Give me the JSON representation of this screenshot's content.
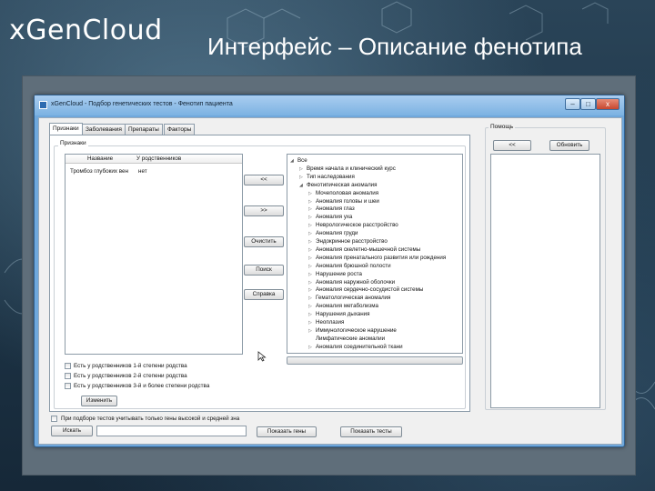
{
  "slide": {
    "logo": {
      "x": "x",
      "gen": "Gen",
      "cloud": "Cloud"
    },
    "title": "Интерфейс – Описание фенотипа"
  },
  "window": {
    "title": "xGenCloud - Подбор генетических тестов - Фенотип пациента",
    "controls": {
      "minimize": "–",
      "maximize": "□",
      "close": "x"
    }
  },
  "tabs": [
    "Признаки",
    "Заболевания",
    "Препараты",
    "Факторы"
  ],
  "features": {
    "group_label": "Признаки",
    "columns": [
      "Название",
      "У родственников"
    ],
    "rows": [
      {
        "name": "Тромбоз глубоких вен",
        "relatives": "нет"
      }
    ]
  },
  "buttons": {
    "move_left": "<<",
    "move_right": ">>",
    "clear": "Очистить",
    "search": "Поиск",
    "help": "Справка",
    "change": "Изменить",
    "find": "Искать",
    "show_genes": "Показать гены",
    "show_tests": "Показать тесты"
  },
  "tree": [
    {
      "label": "Все",
      "level": 0,
      "expanded": true
    },
    {
      "label": "Время начала и клинический курс",
      "level": 1,
      "expanded": false
    },
    {
      "label": "Тип наследования",
      "level": 1,
      "expanded": false
    },
    {
      "label": "Фенотипическая аномалия",
      "level": 1,
      "expanded": true
    },
    {
      "label": "Мочеполовая аномалия",
      "level": 2,
      "expanded": false
    },
    {
      "label": "Аномалия головы и шеи",
      "level": 2,
      "expanded": false
    },
    {
      "label": "Аномалия глаз",
      "level": 2,
      "expanded": false
    },
    {
      "label": "Аномалия уха",
      "level": 2,
      "expanded": false
    },
    {
      "label": "Неврологическое расстройство",
      "level": 2,
      "expanded": false
    },
    {
      "label": "Аномалия груди",
      "level": 2,
      "expanded": false
    },
    {
      "label": "Эндокринное расстройство",
      "level": 2,
      "expanded": false
    },
    {
      "label": "Аномалия скелетно-мышечной системы",
      "level": 2,
      "expanded": false
    },
    {
      "label": "Аномалия пренатального развития или рождения",
      "level": 2,
      "expanded": false
    },
    {
      "label": "Аномалия брюшной полости",
      "level": 2,
      "expanded": false
    },
    {
      "label": "Нарушение роста",
      "level": 2,
      "expanded": false
    },
    {
      "label": "Аномалия наружной оболочки",
      "level": 2,
      "expanded": false
    },
    {
      "label": "Аномалия сердечно-сосудистой системы",
      "level": 2,
      "expanded": false
    },
    {
      "label": "Гематологическая аномалия",
      "level": 2,
      "expanded": false
    },
    {
      "label": "Аномалия метаболизма",
      "level": 2,
      "expanded": false
    },
    {
      "label": "Нарушения дыхания",
      "level": 2,
      "expanded": false
    },
    {
      "label": "Неоплазия",
      "level": 2,
      "expanded": false
    },
    {
      "label": "Иммунологическое нарушение",
      "level": 2,
      "expanded": false
    },
    {
      "label": "Лимфатические аномалии",
      "level": 2,
      "expanded": null
    },
    {
      "label": "Аномалия соединительной ткани",
      "level": 2,
      "expanded": false
    }
  ],
  "relatives_checkboxes": [
    "Есть у родственников 1-й степени родства",
    "Есть у родственников 2-й степени родства",
    "Есть у родственников 3-й и более степени родства"
  ],
  "bottom": {
    "checkbox_label": "При подборе тестов учитывать только гены высокой и средней зна",
    "search_value": ""
  },
  "help": {
    "group_label": "Помощь",
    "back_button": "<<",
    "refresh_button": "Обновить"
  }
}
